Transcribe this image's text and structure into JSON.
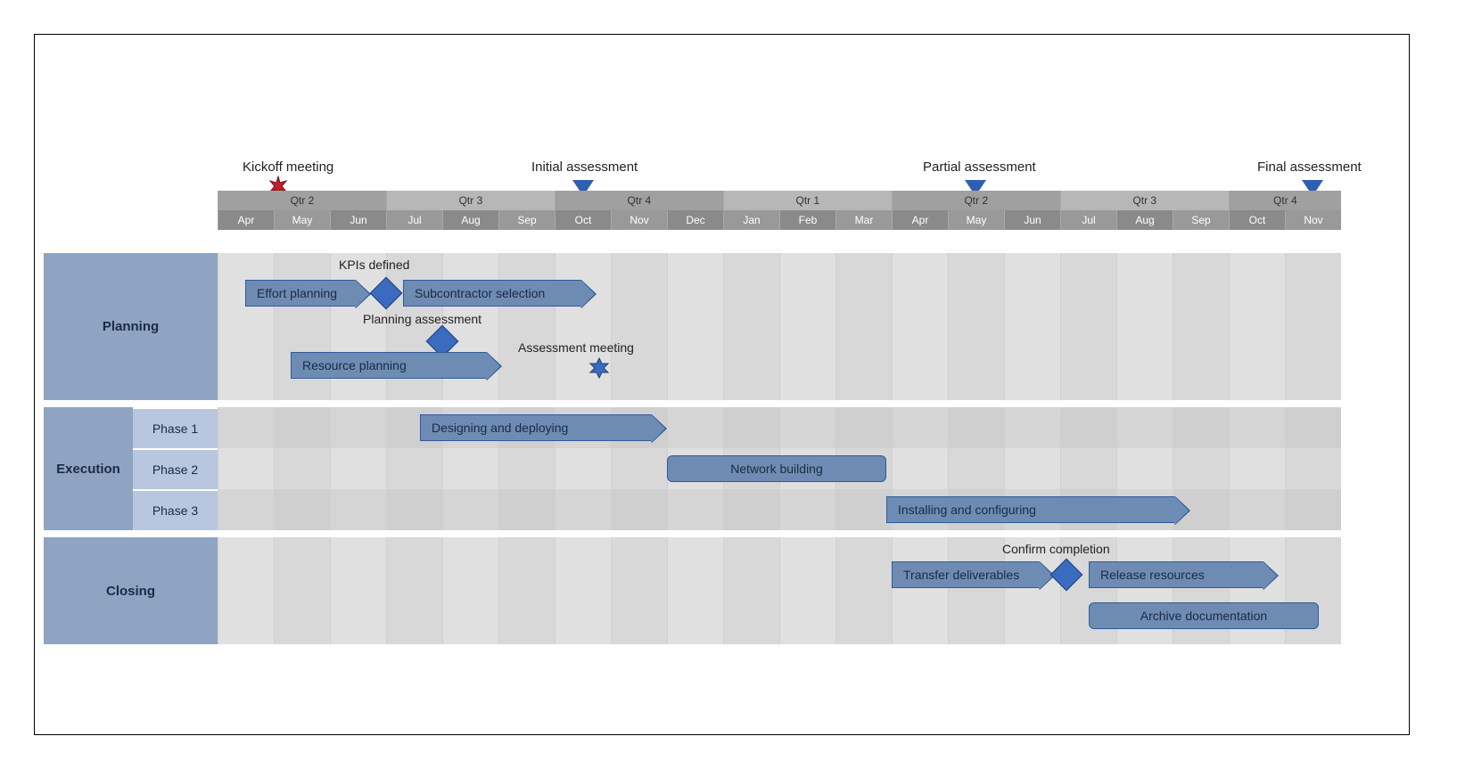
{
  "chart_data": {
    "type": "gantt",
    "time_axis": {
      "quarters": [
        {
          "label": "Qtr 2",
          "months": [
            "Apr",
            "May",
            "Jun"
          ]
        },
        {
          "label": "Qtr 3",
          "months": [
            "Jul",
            "Aug",
            "Sep"
          ]
        },
        {
          "label": "Qtr 4",
          "months": [
            "Oct",
            "Nov",
            "Dec"
          ]
        },
        {
          "label": "Qtr 1",
          "months": [
            "Jan",
            "Feb",
            "Mar"
          ]
        },
        {
          "label": "Qtr 2",
          "months": [
            "Apr",
            "May",
            "Jun"
          ]
        },
        {
          "label": "Qtr 3",
          "months": [
            "Jul",
            "Aug",
            "Sep"
          ]
        },
        {
          "label": "Qtr 4",
          "months": [
            "Oct",
            "Nov"
          ]
        }
      ],
      "month_count": 20
    },
    "top_markers": [
      {
        "label": "Kickoff meeting",
        "month_index": 1,
        "shape": "star",
        "color": "#c0202a"
      },
      {
        "label": "Initial assessment",
        "month_index": 6.5,
        "shape": "triangle",
        "color": "#2e5fb0"
      },
      {
        "label": "Partial assessment",
        "month_index": 13.5,
        "shape": "triangle",
        "color": "#2e5fb0"
      },
      {
        "label": "Final assessment",
        "month_index": 19.5,
        "shape": "triangle",
        "color": "#2e5fb0"
      }
    ],
    "rows": [
      {
        "group": "Planning",
        "subgroup": null,
        "tasks": [
          {
            "label": "Effort planning",
            "start_month": 0.5,
            "end_month": 2.7,
            "shape": "arrow"
          },
          {
            "label": "Subcontractor selection",
            "start_month": 3.3,
            "end_month": 6.7,
            "shape": "arrow"
          },
          {
            "label": "Resource planning",
            "start_month": 1.3,
            "end_month": 5.0,
            "shape": "arrow"
          }
        ],
        "milestones": [
          {
            "label": "KPIs defined",
            "month_index": 3.0
          },
          {
            "label": "Planning assessment",
            "month_index": 4.0
          },
          {
            "label": "Assessment meeting",
            "month_index": 6.8,
            "shape": "star"
          }
        ]
      },
      {
        "group": "Execution",
        "subgroup": "Phase 1",
        "tasks": [
          {
            "label": "Designing and deploying",
            "start_month": 3.6,
            "end_month": 8.0,
            "shape": "arrow"
          }
        ]
      },
      {
        "group": "Execution",
        "subgroup": "Phase 2",
        "tasks": [
          {
            "label": "Network building",
            "start_month": 8.0,
            "end_month": 11.9,
            "shape": "round"
          }
        ]
      },
      {
        "group": "Execution",
        "subgroup": "Phase 3",
        "tasks": [
          {
            "label": "Installing and configuring",
            "start_month": 11.9,
            "end_month": 17.3,
            "shape": "arrow"
          }
        ]
      },
      {
        "group": "Closing",
        "subgroup": null,
        "tasks": [
          {
            "label": "Transfer deliverables",
            "start_month": 12.0,
            "end_month": 14.8,
            "shape": "arrow"
          },
          {
            "label": "Release resources",
            "start_month": 15.5,
            "end_month": 18.8,
            "shape": "arrow"
          },
          {
            "label": "Archive documentation",
            "start_month": 15.5,
            "end_month": 19.6,
            "shape": "round"
          }
        ],
        "milestones": [
          {
            "label": "Confirm completion",
            "month_index": 15.1
          }
        ]
      }
    ]
  },
  "labels": {
    "groups": {
      "planning": "Planning",
      "execution": "Execution",
      "closing": "Closing"
    },
    "phases": {
      "p1": "Phase 1",
      "p2": "Phase 2",
      "p3": "Phase 3"
    },
    "tasks": {
      "effort": "Effort planning",
      "subcon": "Subcontractor selection",
      "resource": "Resource planning",
      "design": "Designing and deploying",
      "network": "Network building",
      "install": "Installing and configuring",
      "transfer": "Transfer deliverables",
      "release": "Release resources",
      "archive": "Archive documentation"
    },
    "milestones": {
      "kpi": "KPIs defined",
      "planassess": "Planning assessment",
      "assessmtg": "Assessment meeting",
      "confirm": "Confirm completion"
    },
    "top": {
      "kickoff": "Kickoff meeting",
      "initial": "Initial assessment",
      "partial": "Partial assessment",
      "final": "Final assessment"
    }
  }
}
